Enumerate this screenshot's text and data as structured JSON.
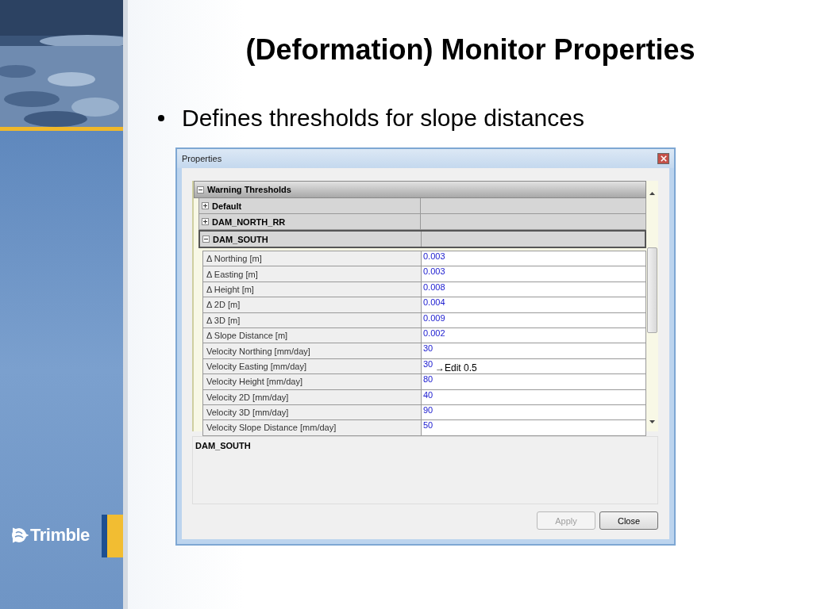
{
  "slide": {
    "title": "(Deformation) Monitor Properties",
    "bullets": [
      "Defines thresholds for slope distances"
    ],
    "logo": "Trimble"
  },
  "dialog": {
    "title": "Properties",
    "category": {
      "label": "Warning Thresholds",
      "expanded": true,
      "children": [
        {
          "label": "Default",
          "expanded": false,
          "selected": false
        },
        {
          "label": "DAM_NORTH_RR",
          "expanded": false,
          "selected": false
        },
        {
          "label": "DAM_SOUTH",
          "expanded": true,
          "selected": true,
          "properties": [
            {
              "name": "Δ Northing [m]",
              "value": "0.003"
            },
            {
              "name": "Δ Easting [m]",
              "value": "0.003"
            },
            {
              "name": "Δ Height [m]",
              "value": "0.008"
            },
            {
              "name": "Δ 2D [m]",
              "value": "0.004"
            },
            {
              "name": "Δ 3D [m]",
              "value": "0.009"
            },
            {
              "name": "Δ Slope Distance [m]",
              "value": "0.002"
            },
            {
              "name": "Velocity Northing [mm/day]",
              "value": "30"
            },
            {
              "name": "Velocity Easting [mm/day]",
              "value": "30"
            },
            {
              "name": "Velocity Height [mm/day]",
              "value": "80"
            },
            {
              "name": "Velocity 2D [mm/day]",
              "value": "40"
            },
            {
              "name": "Velocity 3D [mm/day]",
              "value": "90"
            },
            {
              "name": "Velocity Slope Distance [mm/day]",
              "value": "50"
            }
          ]
        }
      ]
    },
    "annotation": "→Edit 0.5",
    "description": "DAM_SOUTH",
    "buttons": [
      {
        "label": "Apply",
        "disabled": true
      },
      {
        "label": "Close",
        "disabled": false
      }
    ]
  }
}
